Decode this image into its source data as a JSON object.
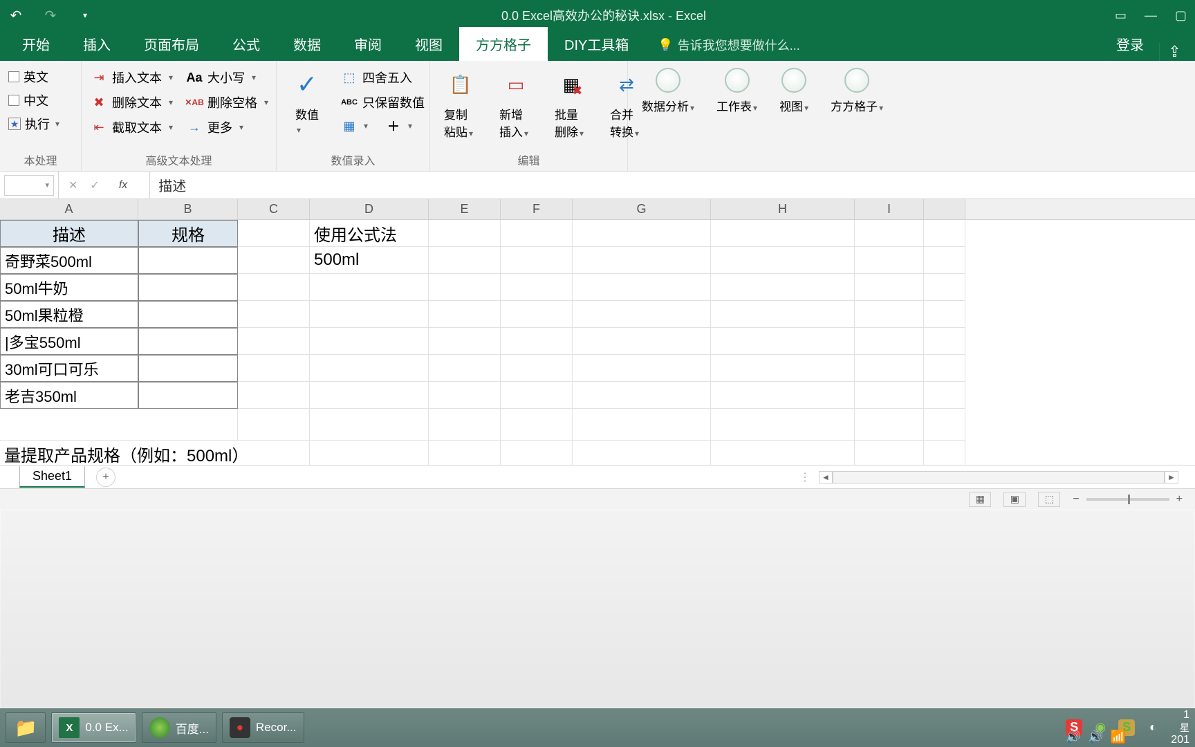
{
  "app": {
    "title": "0.0 Excel高效办公的秘诀.xlsx - Excel"
  },
  "tabs": {
    "items": [
      "开始",
      "插入",
      "页面布局",
      "公式",
      "数据",
      "审阅",
      "视图",
      "方方格子",
      "DIY工具箱"
    ],
    "activeIndex": 7,
    "tellMe": "告诉我您想要做什么...",
    "login": "登录"
  },
  "ribbon": {
    "group1": {
      "label": "本处理",
      "chk_en": "英文",
      "chk_zh": "中文",
      "chk_exec": "执行"
    },
    "group2": {
      "label": "高级文本处理",
      "insert_text": "插入文本",
      "delete_text": "删除文本",
      "extract_text": "截取文本",
      "case": "大小写",
      "delete_space": "删除空格",
      "more": "更多"
    },
    "group3": {
      "label": "数值录入",
      "big_numeric": "数值",
      "round": "四舍五入",
      "keep_numeric": "只保留数值"
    },
    "group4": {
      "label": "编辑",
      "copy_paste": "复制粘贴",
      "insert_new": "新增插入",
      "batch_del": "批量删除",
      "merge_conv": "合并转换"
    },
    "group5": {
      "data_analysis": "数据分析",
      "worksheet": "工作表",
      "view": "视图",
      "ffgz": "方方格子"
    }
  },
  "formula_bar": {
    "value": "描述"
  },
  "columns": [
    "A",
    "B",
    "C",
    "D",
    "E",
    "F",
    "G",
    "H",
    "I"
  ],
  "sheet_data": {
    "header_A": "描述",
    "header_B": "规格",
    "D1": "使用公式法",
    "D2": "500ml",
    "colA": [
      "奇野菜500ml",
      "50ml牛奶",
      "50ml果粒橙",
      "|多宝550ml",
      "30ml可口可乐",
      "老吉350ml"
    ],
    "note": "量提取产品规格（例如：500ml）"
  },
  "sheet_tabs": {
    "active": "Sheet1"
  },
  "taskbar": {
    "excel": "0.0 Ex...",
    "browser": "百度...",
    "recorder": "Recor...",
    "time_top": "1",
    "time_bottom": "201",
    "day": "星"
  }
}
